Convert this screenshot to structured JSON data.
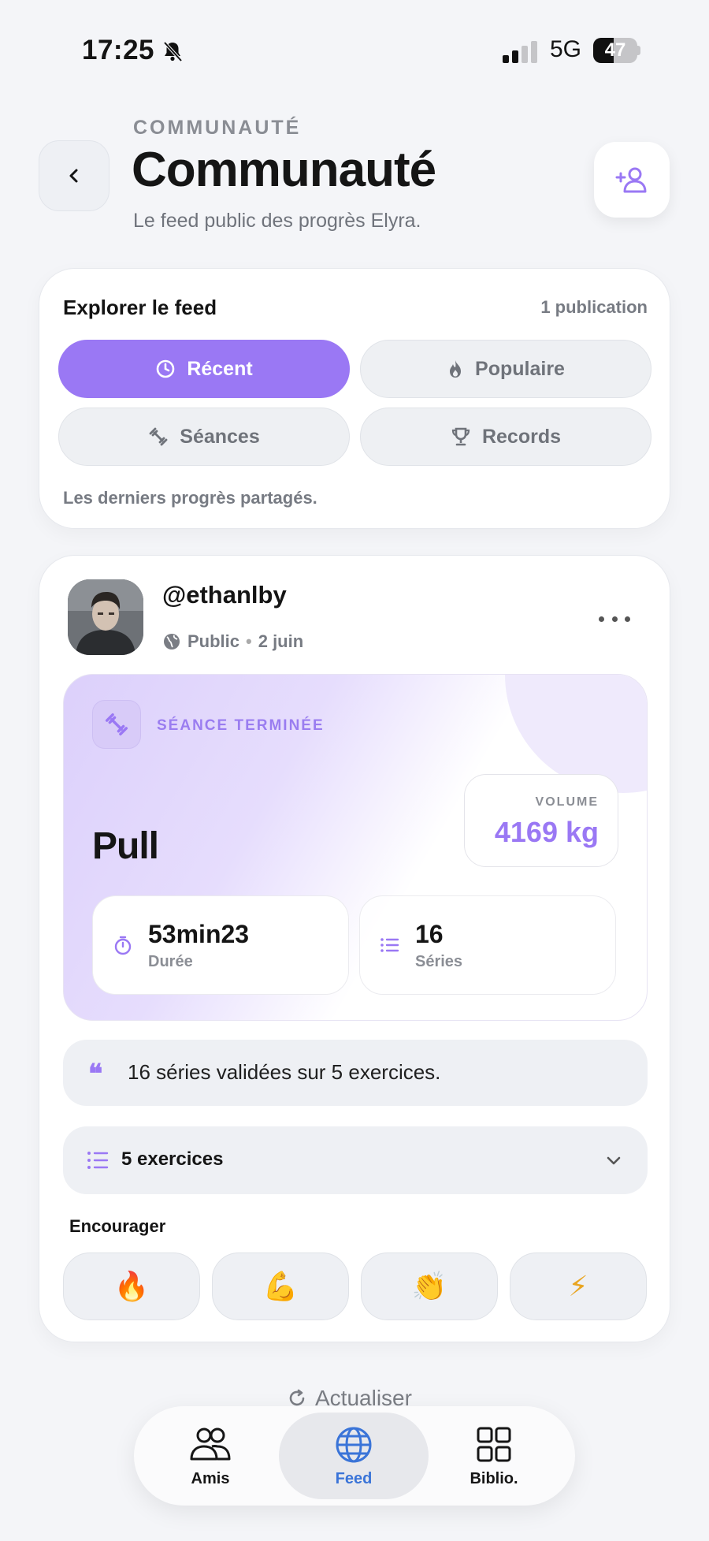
{
  "status_bar": {
    "time": "17:25",
    "network": "5G",
    "battery": "47",
    "battery_level": 0.47
  },
  "header": {
    "eyebrow": "COMMUNAUTÉ",
    "title": "Communauté",
    "subtitle": "Le feed public des progrès Elyra."
  },
  "explore": {
    "title": "Explorer le feed",
    "count": "1 publication",
    "filters": [
      {
        "label": "Récent",
        "icon": "clock-icon",
        "active": true
      },
      {
        "label": "Populaire",
        "icon": "flame-icon",
        "active": false
      },
      {
        "label": "Séances",
        "icon": "dumbbell-icon",
        "active": false
      },
      {
        "label": "Records",
        "icon": "trophy-icon",
        "active": false
      }
    ],
    "caption": "Les derniers progrès partagés."
  },
  "post": {
    "username": "@ethanlby",
    "visibility": "Public",
    "date": "2 juin",
    "session": {
      "badge": "SÉANCE TERMINÉE",
      "name": "Pull",
      "volume_label": "VOLUME",
      "volume_value": "4169 kg",
      "duration_value": "53min23",
      "duration_label": "Durée",
      "series_value": "16",
      "series_label": "Séries"
    },
    "quote": "16 séries validées sur 5 exercices.",
    "exercises_label": "5 exercices",
    "encourage_title": "Encourager",
    "reactions": [
      "🔥",
      "💪",
      "👏",
      "⚡"
    ]
  },
  "refresh_label": "Actualiser",
  "nav": [
    {
      "label": "Amis",
      "icon": "friends-icon"
    },
    {
      "label": "Feed",
      "icon": "globe-icon",
      "active": true
    },
    {
      "label": "Biblio.",
      "icon": "grid-icon"
    }
  ],
  "colors": {
    "accent": "#9a78f4",
    "nav_active": "#3a74d8",
    "background": "#f4f5f8"
  }
}
